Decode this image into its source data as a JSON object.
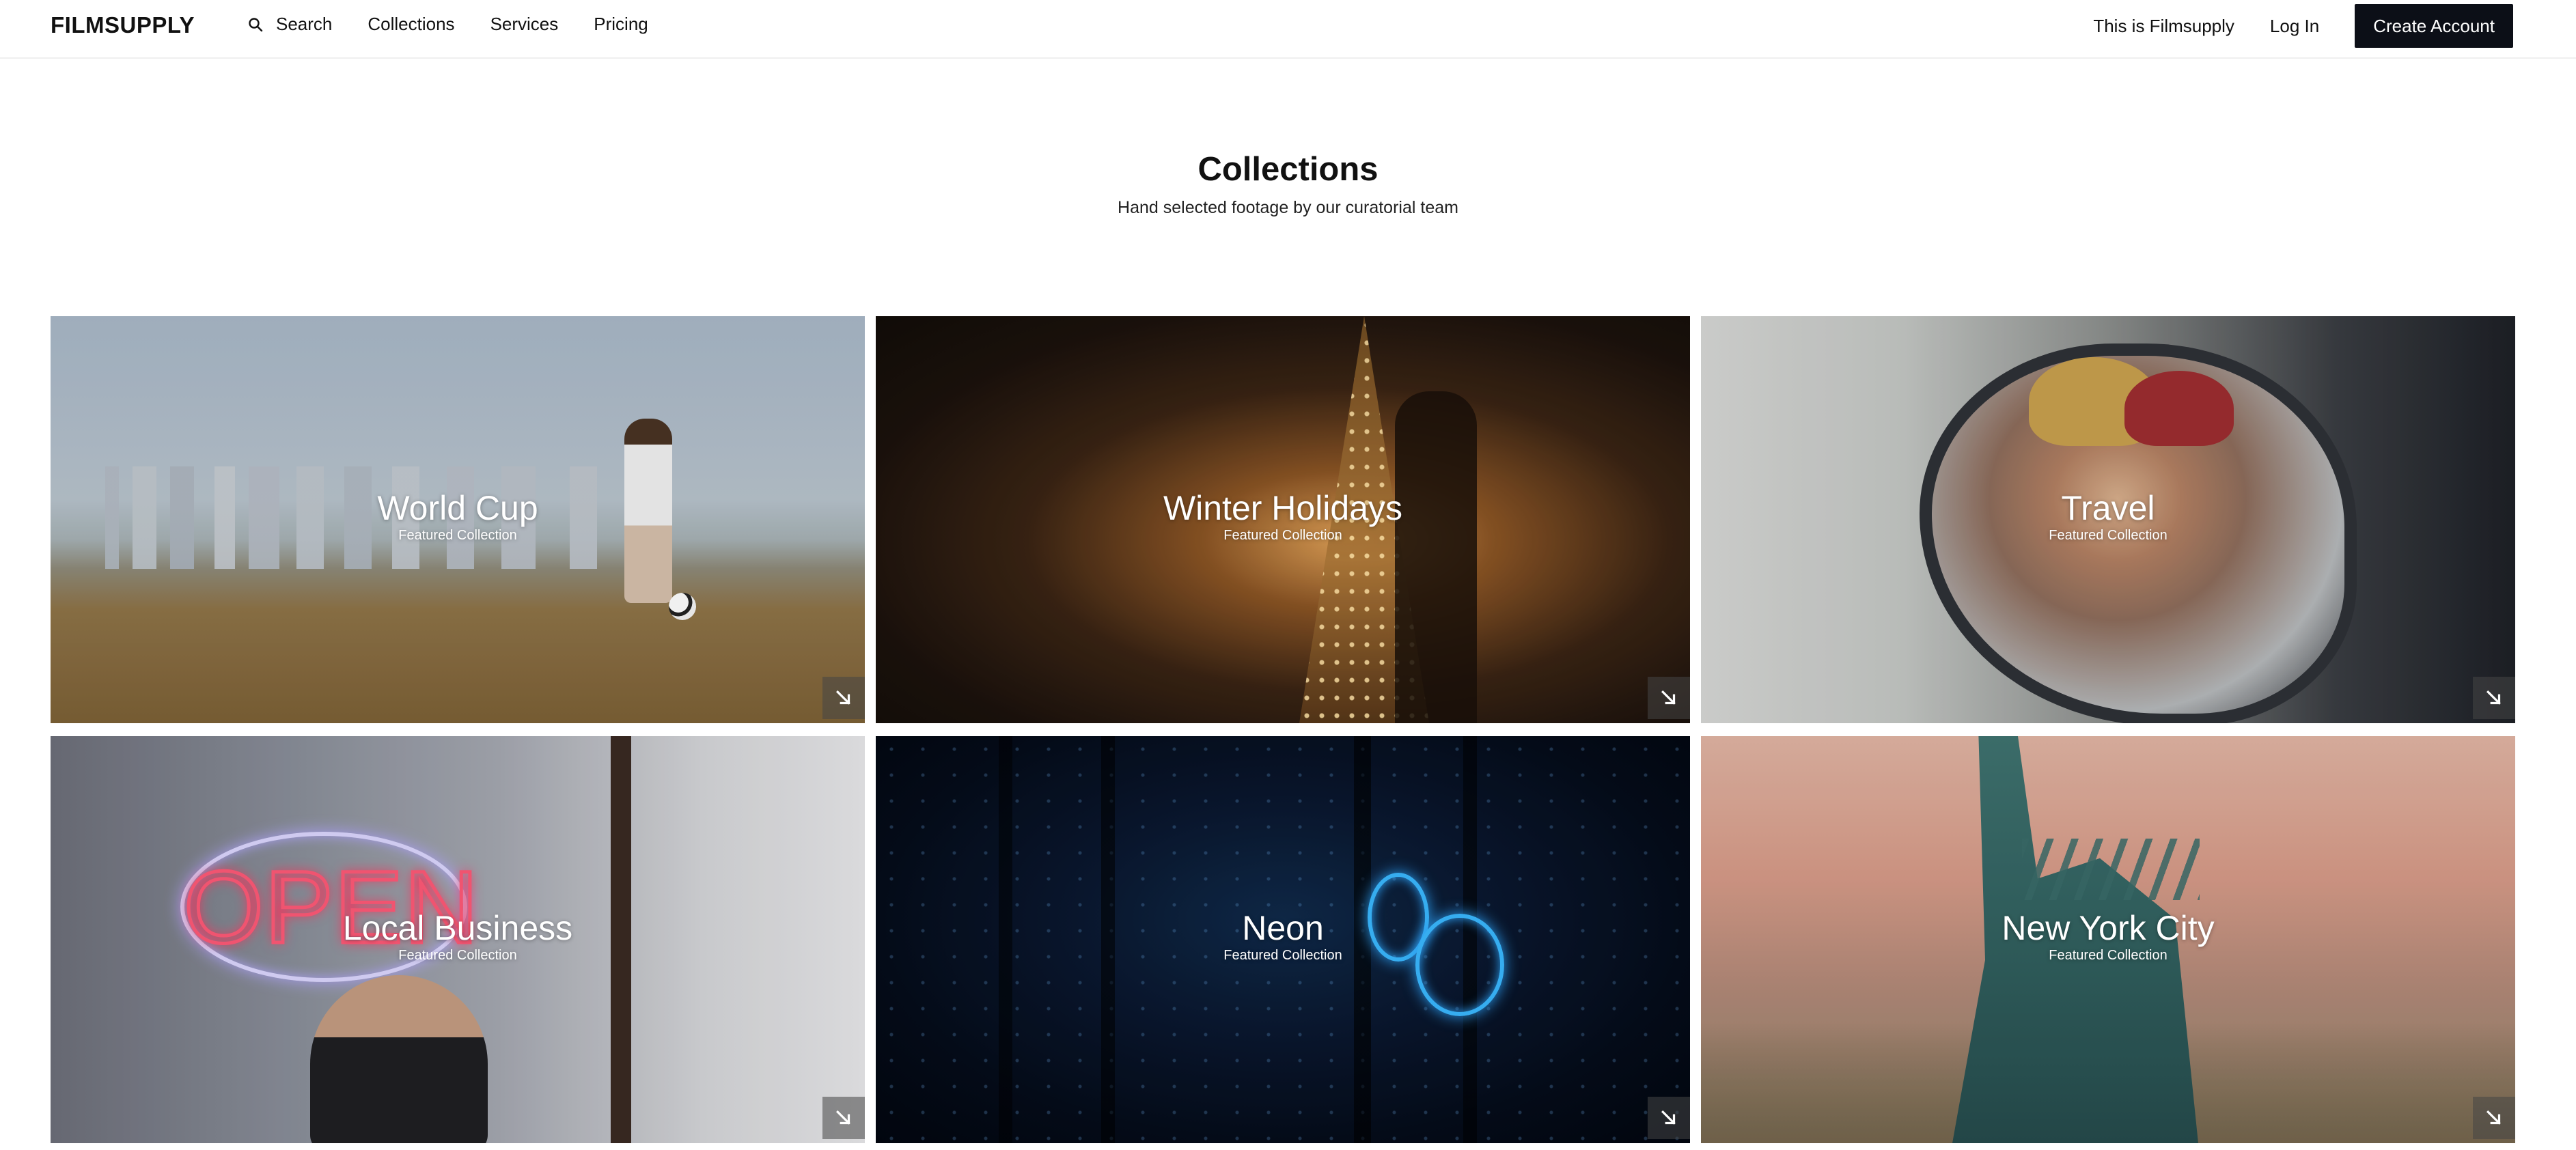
{
  "nav": {
    "logo": "FILMSUPPLY",
    "search_label": "Search",
    "left_links": [
      "Collections",
      "Services",
      "Pricing"
    ],
    "right_links": [
      "This is Filmsupply",
      "Log In"
    ],
    "cta_label": "Create Account",
    "icons": {
      "search": "search-icon"
    }
  },
  "header": {
    "title": "Collections",
    "subtitle": "Hand selected footage by our curatorial team"
  },
  "collections": [
    {
      "title": "World Cup",
      "subtitle": "Featured Collection"
    },
    {
      "title": "Winter Holidays",
      "subtitle": "Featured Collection"
    },
    {
      "title": "Travel",
      "subtitle": "Featured Collection"
    },
    {
      "title": "Local Business",
      "subtitle": "Featured Collection"
    },
    {
      "title": "Neon",
      "subtitle": "Featured Collection"
    },
    {
      "title": "New York City",
      "subtitle": "Featured Collection"
    }
  ],
  "card_icon": "arrow-down-right-icon",
  "colors": {
    "cta_background": "#0c0f17",
    "text": "#111111",
    "background": "#ffffff"
  }
}
